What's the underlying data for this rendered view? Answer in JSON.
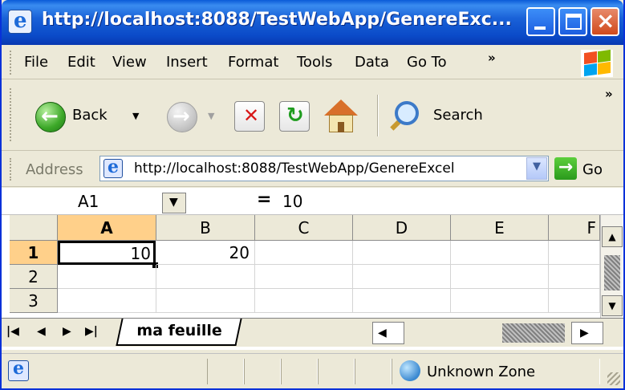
{
  "window": {
    "title": "http://localhost:8088/TestWebApp/GenereExc...",
    "controls": [
      "minimize",
      "maximize",
      "close"
    ]
  },
  "menu": {
    "items": [
      "File",
      "Edit",
      "View",
      "Insert",
      "Format",
      "Tools",
      "Data",
      "Go To"
    ],
    "overflow": "»"
  },
  "toolbar": {
    "back_label": "Back",
    "search_label": "Search",
    "overflow": "»"
  },
  "address": {
    "label": "Address",
    "url": "http://localhost:8088/TestWebApp/GenereExcel",
    "go_label": "Go"
  },
  "excel": {
    "name_box": "A1",
    "equals": "=",
    "formula_value": "10",
    "columns": [
      "A",
      "B",
      "C",
      "D",
      "E",
      "F"
    ],
    "rows": [
      "1",
      "2",
      "3"
    ],
    "cells": {
      "A1": "10",
      "B1": "20"
    },
    "sheet_name": "ma feuille"
  },
  "status": {
    "zone": "Unknown Zone"
  },
  "colors": {
    "titlebar": "#0a4ac8",
    "chrome": "#ece9d8",
    "selected_header": "#ffd08a"
  }
}
